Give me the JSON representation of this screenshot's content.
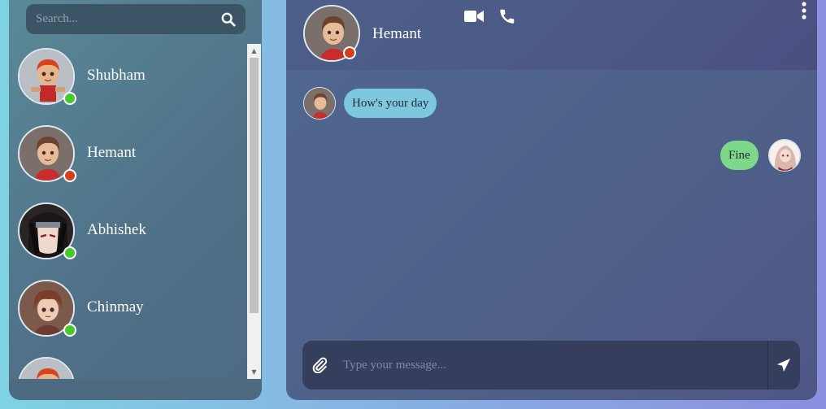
{
  "search": {
    "placeholder": "Search...",
    "icon": "search-icon"
  },
  "contacts": [
    {
      "name": "Shubham",
      "status": "online",
      "avatar": "boy-3d-red-hair"
    },
    {
      "name": "Hemant",
      "status": "offline",
      "avatar": "boy-3d-brown-hair"
    },
    {
      "name": "Abhishek",
      "status": "online",
      "avatar": "anime-dark-hair"
    },
    {
      "name": "Chinmay",
      "status": "online",
      "avatar": "boy-3d-brown-hair-2"
    },
    {
      "name": "",
      "status": "online",
      "avatar": "boy-3d-red-hair"
    }
  ],
  "chat": {
    "contact_name": "Hemant",
    "contact_status": "offline",
    "header_icons": [
      "video-icon",
      "phone-icon",
      "more-vertical-icon"
    ],
    "messages": [
      {
        "direction": "incoming",
        "text": "How's your day"
      },
      {
        "direction": "outgoing",
        "text": "Fine"
      }
    ],
    "composer": {
      "placeholder": "Type your message...",
      "attach_icon": "paperclip-icon",
      "send_icon": "send-icon"
    }
  },
  "colors": {
    "online": "#49c82d",
    "offline": "#d3401c",
    "incoming_bubble": "#7dc8dc",
    "outgoing_bubble": "#7ed88a"
  }
}
